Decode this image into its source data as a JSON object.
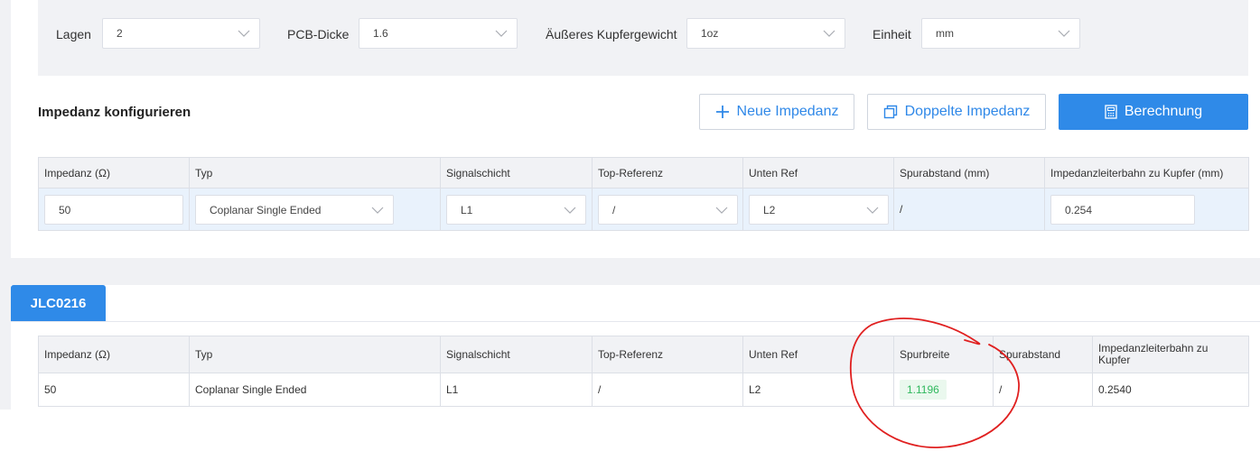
{
  "params": {
    "layers": {
      "label": "Lagen",
      "value": "2"
    },
    "thickness": {
      "label": "PCB-Dicke",
      "value": "1.6"
    },
    "copper": {
      "label": "Äußeres Kupfergewicht",
      "value": "1oz"
    },
    "unit": {
      "label": "Einheit",
      "value": "mm"
    }
  },
  "config": {
    "title": "Impedanz konfigurieren",
    "new_label": "Neue Impedanz",
    "dup_label": "Doppelte Impedanz",
    "calc_label": "Berechnung",
    "headers": [
      "Impedanz (Ω)",
      "Typ",
      "Signalschicht",
      "Top-Referenz",
      "Unten Ref",
      "Spurabstand (mm)",
      "Impedanzleiterbahn zu Kupfer (mm)"
    ],
    "row": {
      "impedance": "50",
      "type": "Coplanar Single Ended",
      "signal": "L1",
      "top_ref": "/",
      "bottom_ref": "L2",
      "spacing": "/",
      "to_copper": "0.254"
    }
  },
  "result": {
    "tab": "JLC0216",
    "headers": [
      "Impedanz (Ω)",
      "Typ",
      "Signalschicht",
      "Top-Referenz",
      "Unten Ref",
      "Spurbreite",
      "Spurabstand",
      "Impedanzleiterbahn zu Kupfer"
    ],
    "row": [
      "50",
      "Coplanar Single Ended",
      "L1",
      "/",
      "L2",
      "1.1196",
      "/",
      "0.2540"
    ]
  },
  "colors": {
    "accent": "#2f8ae8",
    "success": "#2fb85d",
    "annotation": "#e02020"
  }
}
